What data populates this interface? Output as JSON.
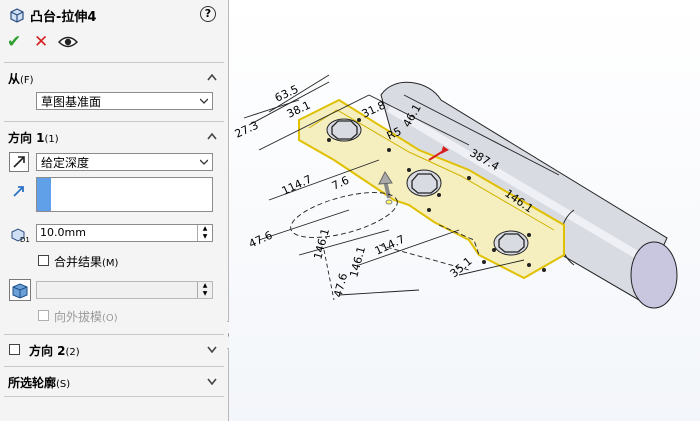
{
  "header": {
    "title": "凸台-拉伸4",
    "help": "?"
  },
  "actions": [
    {
      "name": "ok",
      "glyph": "✔",
      "color": "#2e9e2e"
    },
    {
      "name": "cancel",
      "glyph": "✕",
      "color": "#d62020"
    },
    {
      "name": "preview",
      "glyph": "eye"
    }
  ],
  "from_section": {
    "title": "从",
    "shortcut": "(F)",
    "value": "草图基准面"
  },
  "direction1": {
    "title": "方向 1",
    "shortcut": "(1)",
    "end_condition": "给定深度",
    "depth": "10.0mm",
    "merge_result": "合并结果",
    "merge_shortcut": "(M)",
    "draft_value": "",
    "draft_outward": "向外拔模",
    "draft_outward_shortcut": "(O)"
  },
  "direction2": {
    "title": "方向 2",
    "shortcut": "(2)"
  },
  "selected_contours": {
    "title": "所选轮廓",
    "shortcut": "(S)"
  },
  "dimensions": [
    "63.5",
    "38.1",
    "27.3",
    "31.8",
    "R5",
    "46.1",
    "387.4",
    "114.7",
    "7.6",
    "146.1",
    "47.6",
    "146.1",
    "114.7",
    "146.1",
    "35.1",
    "47.6"
  ],
  "colors": {
    "accent_blue": "#5fa0e8",
    "face_yellow": "#f5efbf",
    "sketch_outline": "#e0c000",
    "pipe_shade": "#c8cbd6"
  }
}
